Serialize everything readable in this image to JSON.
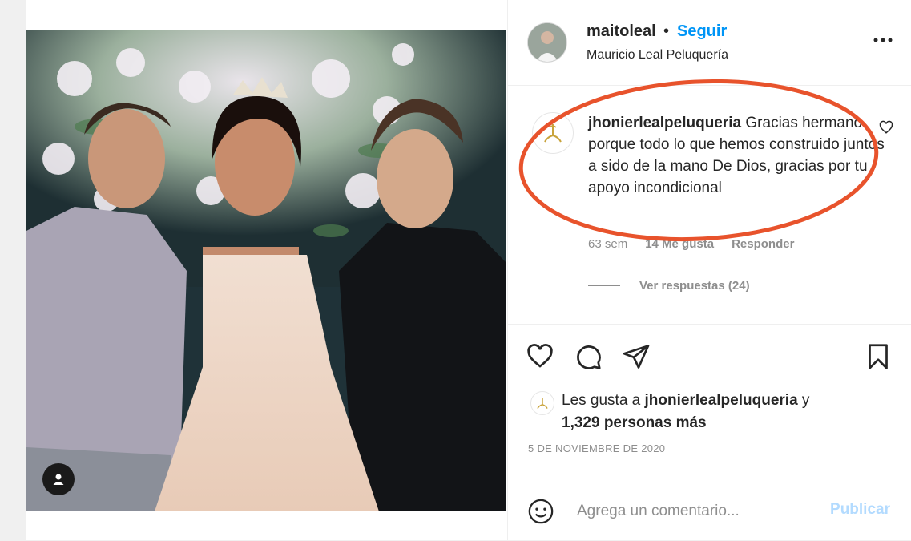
{
  "post": {
    "author": {
      "username": "maitoleal",
      "separator": "•",
      "follow_label": "Seguir",
      "location": "Mauricio Leal Peluquería"
    },
    "media": {
      "icons": {
        "tag": "user-tag-icon"
      }
    },
    "comment": {
      "username": "jhonierlealpeluqueria",
      "text": "Gracias hermano porque todo lo que hemos construido juntos a sido de la mano De Dios, gracias por tu apoyo incondicional",
      "time": "63 sem",
      "likes": "14 Me gusta",
      "reply_label": "Responder",
      "view_replies_label": "Ver respuestas (24)"
    },
    "actions": {
      "icons": [
        "heart-icon",
        "comment-icon",
        "share-icon",
        "bookmark-icon"
      ]
    },
    "likes": {
      "prefix": "Les gusta a ",
      "user": "jhonierlealpeluqueria",
      "conj": " y",
      "others": "1,329 personas más"
    },
    "date": "5 DE NOVIEMBRE DE 2020",
    "composer": {
      "placeholder": "Agrega un comentario...",
      "publish_label": "Publicar"
    },
    "colors": {
      "link": "#0095f6",
      "muted": "#8e8e8e",
      "publish_disabled": "#b3dbff",
      "annotation": "#e8532c"
    }
  }
}
